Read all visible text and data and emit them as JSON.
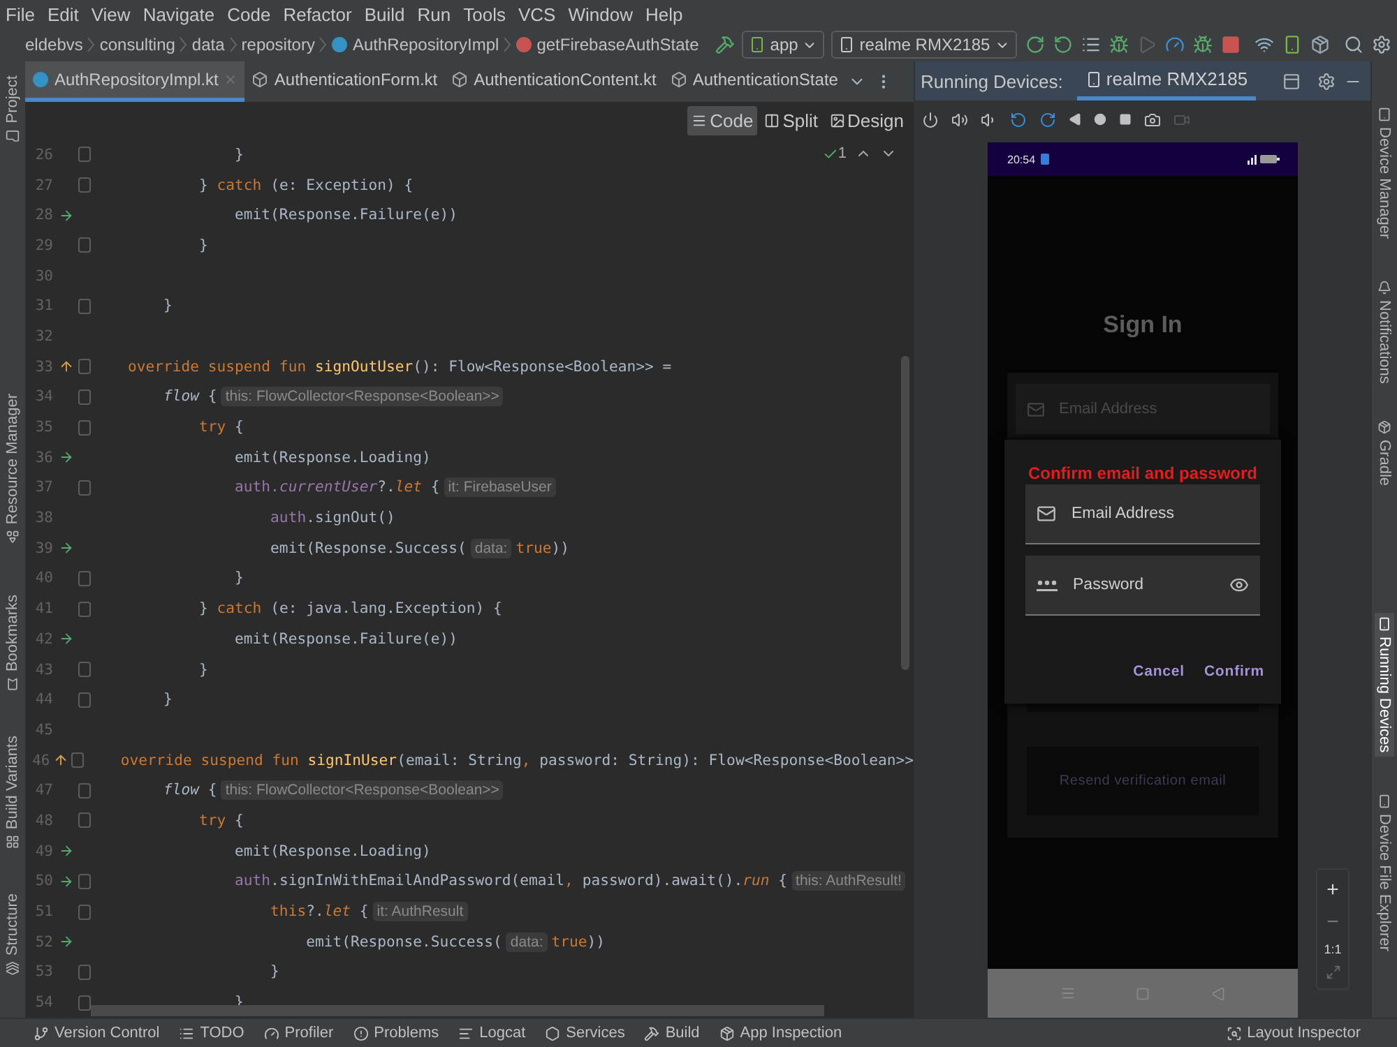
{
  "menu": [
    "File",
    "Edit",
    "View",
    "Navigate",
    "Code",
    "Refactor",
    "Build",
    "Run",
    "Tools",
    "VCS",
    "Window",
    "Help"
  ],
  "breadcrumb": [
    {
      "label": "eldebvs",
      "kind": "package"
    },
    {
      "label": "consulting",
      "kind": "package"
    },
    {
      "label": "data",
      "kind": "package"
    },
    {
      "label": "repository",
      "kind": "package"
    },
    {
      "label": "AuthRepositoryImpl",
      "kind": "class"
    },
    {
      "label": "getFirebaseAuthState",
      "kind": "method"
    }
  ],
  "toolbar": {
    "configuration": "app",
    "device": "realme RMX2185"
  },
  "editor_tabs": [
    {
      "label": "AuthRepositoryImpl.kt",
      "selected": true,
      "kind": "class"
    },
    {
      "label": "AuthenticationForm.kt",
      "selected": false,
      "kind": "file"
    },
    {
      "label": "AuthenticationContent.kt",
      "selected": false,
      "kind": "file"
    },
    {
      "label": "AuthenticationState",
      "selected": false,
      "kind": "file"
    }
  ],
  "view_modes": [
    {
      "label": "Code",
      "selected": true
    },
    {
      "label": "Split",
      "selected": false
    },
    {
      "label": "Design",
      "selected": false
    }
  ],
  "inspection_count": "1",
  "left_tools": [
    {
      "label": "Project"
    },
    {
      "label": "Resource Manager"
    },
    {
      "label": "Bookmarks"
    },
    {
      "label": "Build Variants"
    },
    {
      "label": "Structure"
    }
  ],
  "right_tools": [
    {
      "label": "Device Manager",
      "selected": false
    },
    {
      "label": "Notifications",
      "selected": false
    },
    {
      "label": "Gradle",
      "selected": false
    },
    {
      "label": "Running Devices",
      "selected": true
    },
    {
      "label": "Device File Explorer",
      "selected": false
    }
  ],
  "code_lines": [
    {
      "number": "26",
      "kind": "plain",
      "fold": true,
      "tokens": [
        {
          "kind": "plain",
          "text": "                }"
        }
      ]
    },
    {
      "number": "27",
      "kind": "plain",
      "fold": true,
      "tokens": [
        {
          "kind": "plain",
          "text": "            } "
        },
        {
          "kind": "keyword",
          "text": "catch"
        },
        {
          "kind": "plain",
          "text": " (e: Exception) {"
        }
      ]
    },
    {
      "number": "28",
      "kind": "run",
      "fold": false,
      "tokens": [
        {
          "kind": "plain",
          "text": "                emit(Response.Failure(e))"
        }
      ]
    },
    {
      "number": "29",
      "kind": "plain",
      "fold": true,
      "tokens": [
        {
          "kind": "plain",
          "text": "            }"
        }
      ]
    },
    {
      "number": "30",
      "kind": "plain",
      "fold": false
    },
    {
      "number": "31",
      "kind": "plain",
      "fold": true,
      "tokens": [
        {
          "kind": "plain",
          "text": "        }"
        }
      ]
    },
    {
      "number": "32",
      "kind": "plain",
      "fold": false
    },
    {
      "number": "33",
      "kind": "override",
      "fold": true,
      "tokens": [
        {
          "kind": "keyword",
          "text": "    override suspend fun "
        },
        {
          "kind": "function",
          "text": "signOutUser"
        },
        {
          "kind": "plain",
          "text": "(): Flow<Response<Boolean>> ="
        }
      ]
    },
    {
      "number": "34",
      "kind": "plain",
      "fold": true,
      "tokens": [
        {
          "kind": "italic",
          "text": "        flow"
        },
        {
          "kind": "plain",
          "text": " {"
        },
        {
          "kind": "hint",
          "text": "this: FlowCollector<Response<Boolean>>"
        }
      ]
    },
    {
      "number": "35",
      "kind": "plain",
      "fold": true,
      "tokens": [
        {
          "kind": "keyword",
          "text": "            try"
        },
        {
          "kind": "plain",
          "text": " {"
        }
      ]
    },
    {
      "number": "36",
      "kind": "run",
      "fold": false,
      "tokens": [
        {
          "kind": "plain",
          "text": "                emit(Response.Loading)"
        }
      ]
    },
    {
      "number": "37",
      "kind": "plain",
      "fold": true,
      "tokens": [
        {
          "kind": "property",
          "text": "                auth."
        },
        {
          "kind": "property-italic",
          "text": "currentUser"
        },
        {
          "kind": "plain",
          "text": "?."
        },
        {
          "kind": "keyword-italic",
          "text": "let"
        },
        {
          "kind": "plain",
          "text": " {"
        },
        {
          "kind": "hint",
          "text": "it: FirebaseUser"
        }
      ]
    },
    {
      "number": "38",
      "kind": "plain",
      "fold": false,
      "tokens": [
        {
          "kind": "property",
          "text": "                    auth"
        },
        {
          "kind": "plain",
          "text": ".signOut()"
        }
      ]
    },
    {
      "number": "39",
      "kind": "run",
      "fold": false,
      "tokens": [
        {
          "kind": "plain",
          "text": "                    emit(Response.Success("
        },
        {
          "kind": "hint",
          "text": "data:"
        },
        {
          "kind": "keyword",
          "text": "true"
        },
        {
          "kind": "plain",
          "text": "))"
        }
      ]
    },
    {
      "number": "40",
      "kind": "plain",
      "fold": true,
      "tokens": [
        {
          "kind": "plain",
          "text": "                }"
        }
      ]
    },
    {
      "number": "41",
      "kind": "plain",
      "fold": true,
      "tokens": [
        {
          "kind": "plain",
          "text": "            } "
        },
        {
          "kind": "keyword",
          "text": "catch"
        },
        {
          "kind": "plain",
          "text": " (e: java.lang.Exception) {"
        }
      ]
    },
    {
      "number": "42",
      "kind": "run",
      "fold": false,
      "tokens": [
        {
          "kind": "plain",
          "text": "                emit(Response.Failure(e))"
        }
      ]
    },
    {
      "number": "43",
      "kind": "plain",
      "fold": true,
      "tokens": [
        {
          "kind": "plain",
          "text": "            }"
        }
      ]
    },
    {
      "number": "44",
      "kind": "plain",
      "fold": true,
      "tokens": [
        {
          "kind": "plain",
          "text": "        }"
        }
      ]
    },
    {
      "number": "45",
      "kind": "plain",
      "fold": false
    },
    {
      "number": "46",
      "kind": "override",
      "fold": true,
      "tokens": [
        {
          "kind": "keyword",
          "text": "    override suspend fun "
        },
        {
          "kind": "function",
          "text": "signInUser"
        },
        {
          "kind": "plain",
          "text": "(email: String"
        },
        {
          "kind": "keyword",
          "text": ", "
        },
        {
          "kind": "plain",
          "text": "password: String): Flow<Response<Boolean>>"
        }
      ]
    },
    {
      "number": "47",
      "kind": "plain",
      "fold": true,
      "tokens": [
        {
          "kind": "italic",
          "text": "        flow"
        },
        {
          "kind": "plain",
          "text": " {"
        },
        {
          "kind": "hint",
          "text": "this: FlowCollector<Response<Boolean>>"
        }
      ]
    },
    {
      "number": "48",
      "kind": "plain",
      "fold": true,
      "tokens": [
        {
          "kind": "keyword",
          "text": "            try"
        },
        {
          "kind": "plain",
          "text": " {"
        }
      ]
    },
    {
      "number": "49",
      "kind": "run",
      "fold": false,
      "tokens": [
        {
          "kind": "plain",
          "text": "                emit(Response.Loading)"
        }
      ]
    },
    {
      "number": "50",
      "kind": "run",
      "fold": true,
      "tokens": [
        {
          "kind": "property",
          "text": "                auth"
        },
        {
          "kind": "plain",
          "text": ".signInWithEmailAndPassword(email"
        },
        {
          "kind": "keyword",
          "text": ", "
        },
        {
          "kind": "plain",
          "text": "password).await()."
        },
        {
          "kind": "keyword-italic",
          "text": "run"
        },
        {
          "kind": "plain",
          "text": " {"
        },
        {
          "kind": "hint",
          "text": "this: AuthResult!"
        }
      ]
    },
    {
      "number": "51",
      "kind": "plain",
      "fold": true,
      "tokens": [
        {
          "kind": "keyword",
          "text": "                    this"
        },
        {
          "kind": "plain",
          "text": "?."
        },
        {
          "kind": "keyword-italic",
          "text": "let"
        },
        {
          "kind": "plain",
          "text": " {"
        },
        {
          "kind": "hint",
          "text": "it: AuthResult"
        }
      ]
    },
    {
      "number": "52",
      "kind": "run",
      "fold": false,
      "tokens": [
        {
          "kind": "plain",
          "text": "                        emit(Response.Success("
        },
        {
          "kind": "hint",
          "text": "data:"
        },
        {
          "kind": "keyword",
          "text": "true"
        },
        {
          "kind": "plain",
          "text": "))"
        }
      ]
    },
    {
      "number": "53",
      "kind": "plain",
      "fold": true,
      "tokens": [
        {
          "kind": "plain",
          "text": "                    }"
        }
      ]
    },
    {
      "number": "54",
      "kind": "plain",
      "fold": true,
      "tokens": [
        {
          "kind": "plain",
          "text": "                }"
        }
      ]
    }
  ],
  "running_devices": {
    "title": "Running Devices:",
    "tab": "realme RMX2185"
  },
  "phone": {
    "time": "20:54",
    "title": "Sign In",
    "background_field": {
      "placeholder": "Email Address"
    },
    "dialog": {
      "title": "Confirm email and password",
      "fields": [
        {
          "kind": "email",
          "placeholder": "Email Address"
        },
        {
          "kind": "password",
          "placeholder": "Password"
        }
      ],
      "buttons": [
        "Cancel",
        "Confirm"
      ]
    },
    "resend_button": "Resend verification email"
  },
  "zoom_controls": [
    {
      "kind": "plus",
      "label": "+"
    },
    {
      "kind": "minus",
      "label": "−"
    },
    {
      "kind": "actual",
      "label": "1:1"
    },
    {
      "kind": "fit"
    }
  ],
  "status_bar": {
    "tools": [
      {
        "kind": "vcs",
        "label": "Version Control"
      },
      {
        "kind": "todo",
        "label": "TODO"
      },
      {
        "kind": "profiler",
        "label": "Profiler"
      },
      {
        "kind": "problems",
        "label": "Problems"
      },
      {
        "kind": "logcat",
        "label": "Logcat"
      },
      {
        "kind": "services",
        "label": "Services"
      },
      {
        "kind": "build",
        "label": "Build"
      },
      {
        "kind": "inspection",
        "label": "App Inspection"
      }
    ],
    "right": "Layout Inspector"
  }
}
